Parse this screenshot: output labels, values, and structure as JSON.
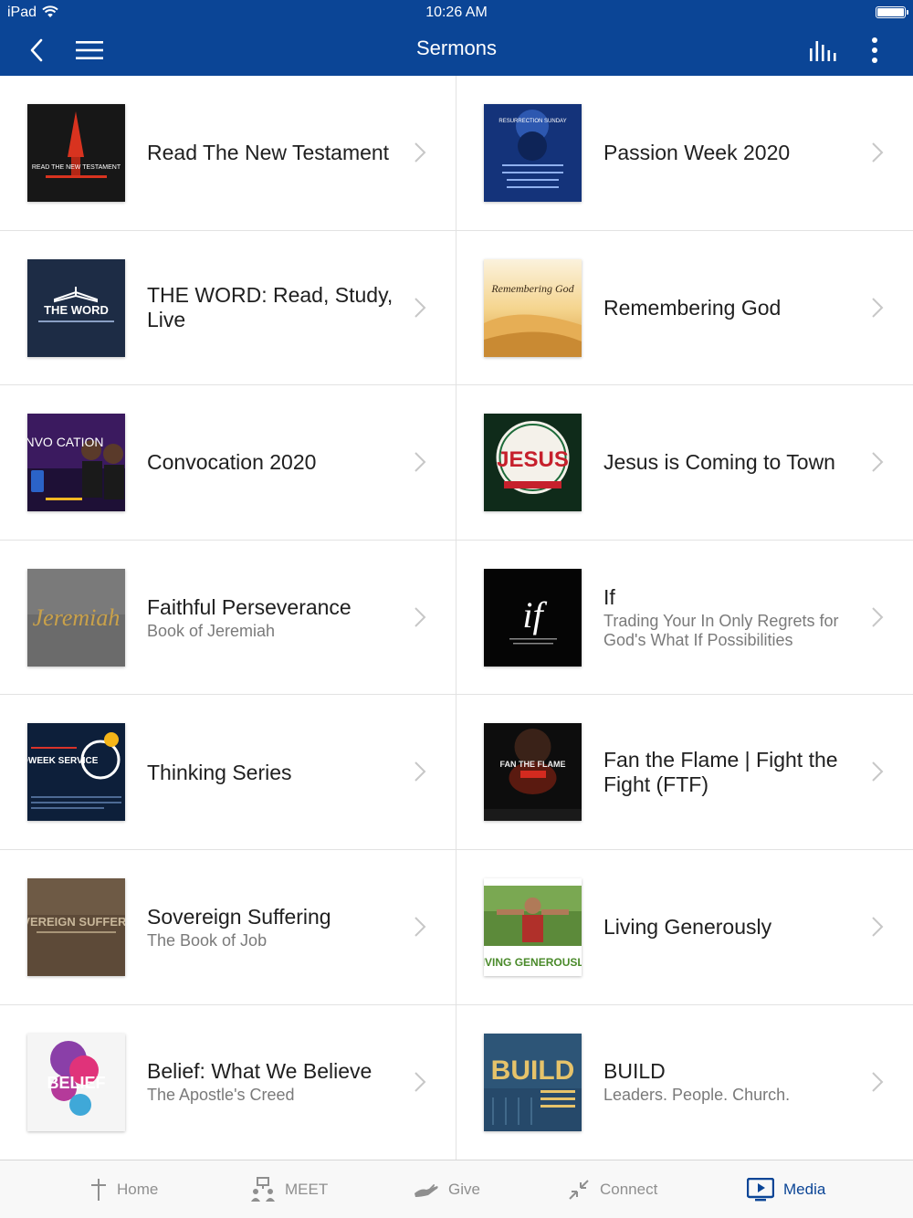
{
  "status_bar": {
    "carrier": "iPad",
    "time": "10:26 AM"
  },
  "nav": {
    "title": "Sermons"
  },
  "sermons": [
    {
      "title": "Read The New Testament",
      "subtitle": "",
      "thumb_text": "READ THE NEW TESTAMENT"
    },
    {
      "title": "Passion Week 2020",
      "subtitle": "",
      "thumb_text": "RESURRECTION SUNDAY"
    },
    {
      "title": "THE WORD: Read, Study, Live",
      "subtitle": "",
      "thumb_text": "THE WORD"
    },
    {
      "title": "Remembering God",
      "subtitle": "",
      "thumb_text": "Remembering God"
    },
    {
      "title": "Convocation 2020",
      "subtitle": "",
      "thumb_text": "CONVO CATION"
    },
    {
      "title": "Jesus is Coming to Town",
      "subtitle": "",
      "thumb_text": "JESUS"
    },
    {
      "title": "Faithful Perseverance",
      "subtitle": "Book of Jeremiah",
      "thumb_text": "Jeremiah"
    },
    {
      "title": "If",
      "subtitle": "Trading Your In Only Regrets for God's What If Possibilities",
      "thumb_text": "if"
    },
    {
      "title": "Thinking Series",
      "subtitle": "",
      "thumb_text": "MIDWEEK SERVICE"
    },
    {
      "title": "Fan the Flame | Fight the Fight (FTF)",
      "subtitle": "",
      "thumb_text": "FAN THE FLAME"
    },
    {
      "title": "Sovereign Suffering",
      "subtitle": "The Book of Job",
      "thumb_text": "SOVEREIGN SUFFERING"
    },
    {
      "title": "Living Generously",
      "subtitle": "",
      "thumb_text": "LIVING GENEROUSLY"
    },
    {
      "title": "Belief: What We Believe",
      "subtitle": "The Apostle's Creed",
      "thumb_text": "BELIEF"
    },
    {
      "title": "BUILD",
      "subtitle": "Leaders. People. Church.",
      "thumb_text": "BUILD"
    }
  ],
  "tabs": [
    {
      "label": "Home",
      "icon": "cross-icon",
      "active": false
    },
    {
      "label": "MEET",
      "icon": "people-icon",
      "active": false
    },
    {
      "label": "Give",
      "icon": "hand-icon",
      "active": false
    },
    {
      "label": "Connect",
      "icon": "arrows-in-icon",
      "active": false
    },
    {
      "label": "Media",
      "icon": "media-play-icon",
      "active": true
    }
  ],
  "colors": {
    "nav_bg": "#0b4596",
    "active_tab": "#0b4596",
    "inactive_tab": "#8f8f8f"
  }
}
